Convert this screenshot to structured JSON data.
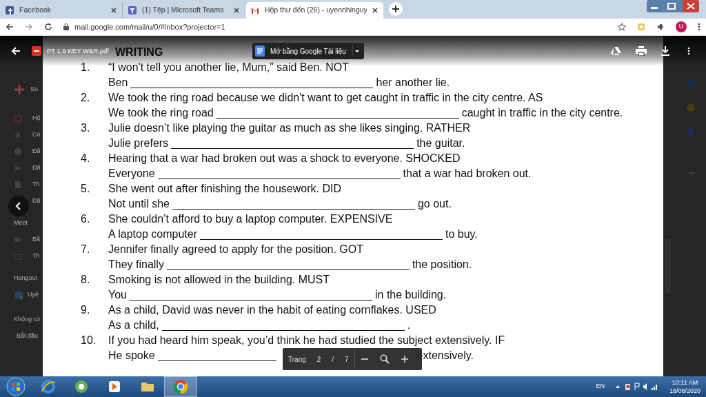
{
  "browser": {
    "tabs": [
      {
        "title": "Facebook",
        "selected": false
      },
      {
        "title": "(1) Tệp | Microsoft Teams",
        "selected": false
      },
      {
        "title": "Hộp thư đến (26) - uyennhinguy",
        "selected": true
      }
    ],
    "address": "mail.google.com/mail/u/0/#inbox?projector=1",
    "profile_initial": "U"
  },
  "gmail_sidebar": {
    "compose": "So",
    "items": [
      {
        "kind": "item",
        "label": "Hộ"
      },
      {
        "kind": "item",
        "label": "Cò"
      },
      {
        "kind": "item",
        "label": "Đã"
      },
      {
        "kind": "item",
        "label": "Đã"
      },
      {
        "kind": "item",
        "label": "Th"
      },
      {
        "kind": "item",
        "label": "Đã"
      },
      {
        "kind": "header",
        "label": "Meet"
      },
      {
        "kind": "item",
        "label": "Bắ"
      },
      {
        "kind": "item",
        "label": "Th"
      },
      {
        "kind": "header",
        "label": "Hangout"
      },
      {
        "kind": "person",
        "label": "Uyê"
      },
      {
        "kind": "note",
        "label": "Không có"
      },
      {
        "kind": "link",
        "label": "Bắt đầu"
      }
    ]
  },
  "viewer": {
    "file_name": "PT 1.9 KEY W&R.pdf",
    "open_with": "Mở bằng Google Tài liệu",
    "heading": "WRITING",
    "exercises": [
      {
        "number": "1.",
        "prompt": "“I won't tell you another lie, Mum,” said Ben. NOT",
        "answer_start": "Ben",
        "answer_end": "her another lie."
      },
      {
        "number": "2.",
        "prompt": "We took the ring road because we didn't want to get caught in traffic in the city centre. AS",
        "answer_start": "We took the ring road",
        "answer_end": "caught in traffic in the city centre."
      },
      {
        "number": "3.",
        "prompt": "Julie doesn’t like playing the guitar as much as she likes singing. RATHER",
        "answer_start": "Julie prefers",
        "answer_end": "the guitar."
      },
      {
        "number": "4.",
        "prompt": "Hearing that a war had broken out was a shock to everyone. SHOCKED",
        "answer_start": "Everyone",
        "answer_end": "that a war had broken out."
      },
      {
        "number": "5.",
        "prompt": "She went out after finishing the housework. DID",
        "answer_start": "Not until she",
        "answer_end": "go out."
      },
      {
        "number": "6.",
        "prompt": "She couldn’t afford to buy a laptop computer. EXPENSIVE",
        "answer_start": "A laptop computer",
        "answer_end": "to buy."
      },
      {
        "number": "7.",
        "prompt": "Jennifer finally agreed to apply for the position. GOT",
        "answer_start": "They finally",
        "answer_end": "the position."
      },
      {
        "number": "8.",
        "prompt": "Smoking is not allowed in the building. MUST",
        "answer_start": "You",
        "answer_end": "in the building."
      },
      {
        "number": "9.",
        "prompt": "As a child, David was never in the habit of eating cornflakes. USED",
        "answer_start": "As a child,",
        "answer_end": "."
      },
      {
        "number": "10.",
        "prompt": "If you had heard him speak, you’d think he had studied the subject extensively. IF",
        "answer_start": "He spoke",
        "answer_end": "extensively."
      }
    ],
    "page_label": "Trang",
    "page": "2",
    "page_separator": "/",
    "page_count": "7"
  },
  "taskbar": {
    "apps": [
      {
        "selected": false
      },
      {
        "selected": false
      },
      {
        "selected": false
      },
      {
        "selected": false
      },
      {
        "selected": true
      }
    ],
    "language": "EN",
    "time": "10:11 AM",
    "date": "18/08/2020"
  }
}
